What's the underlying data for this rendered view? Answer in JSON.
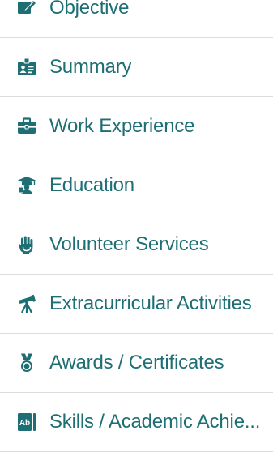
{
  "accent_color": "#1d6f74",
  "menu": {
    "items": [
      {
        "label": "Objective",
        "icon": "edit-note-icon"
      },
      {
        "label": "Summary",
        "icon": "id-badge-icon"
      },
      {
        "label": "Work Experience",
        "icon": "briefcase-icon"
      },
      {
        "label": "Education",
        "icon": "graduate-icon"
      },
      {
        "label": "Volunteer Services",
        "icon": "hand-icon"
      },
      {
        "label": "Extracurricular Activities",
        "icon": "telescope-icon"
      },
      {
        "label": "Awards / Certificates",
        "icon": "medal-icon"
      },
      {
        "label": "Skills / Academic Achie...",
        "icon": "ab-badge-icon"
      }
    ]
  }
}
